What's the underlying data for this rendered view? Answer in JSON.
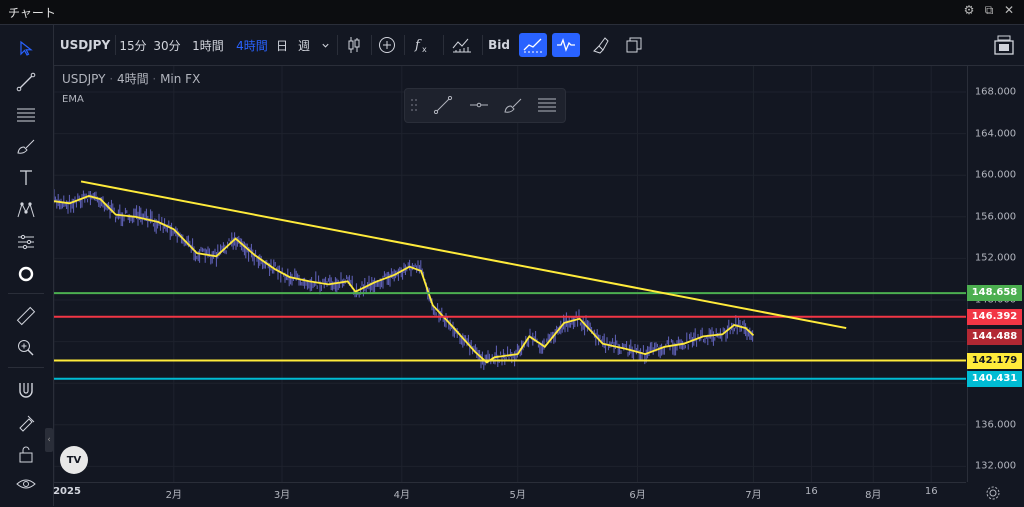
{
  "window": {
    "title": "チャート"
  },
  "toolbar": {
    "symbol": "USDJPY",
    "intervals": [
      {
        "label": "15分",
        "active": false
      },
      {
        "label": "30分",
        "active": false
      },
      {
        "label": "1時間",
        "active": false
      },
      {
        "label": "4時間",
        "active": true
      },
      {
        "label": "日",
        "active": false
      },
      {
        "label": "週",
        "active": false
      }
    ],
    "price_source": "Bid"
  },
  "legend": {
    "symbol": "USDJPY",
    "interval": "4時間",
    "source": "Min FX",
    "indicator": "EMA"
  },
  "price_axis": {
    "ticks": [
      "168.000",
      "164.000",
      "160.000",
      "156.000",
      "152.000",
      "148.000",
      "144.000",
      "140.000",
      "136.000",
      "132.000"
    ]
  },
  "time_axis": {
    "ticks": [
      "2025",
      "2月",
      "3月",
      "4月",
      "5月",
      "6月",
      "7月",
      "16",
      "8月",
      "16"
    ]
  },
  "price_labels": [
    {
      "value": "148.658",
      "bg": "#4caf50",
      "fg": "#ffffff"
    },
    {
      "value": "146.392",
      "bg": "#f23645",
      "fg": "#ffffff"
    },
    {
      "value": "144.488",
      "bg": "#b22833",
      "fg": "#ffffff"
    },
    {
      "value": "142.179",
      "bg": "#ffeb3b",
      "fg": "#131722"
    },
    {
      "value": "140.431",
      "bg": "#00bcd4",
      "fg": "#ffffff"
    }
  ],
  "horizontal_lines": [
    {
      "name": "green",
      "price": 148.658,
      "color": "#4caf50"
    },
    {
      "name": "red",
      "price": 146.392,
      "color": "#f23645"
    },
    {
      "name": "yellow",
      "price": 142.179,
      "color": "#ffeb3b"
    },
    {
      "name": "cyan",
      "price": 140.431,
      "color": "#00bcd4"
    }
  ],
  "trendline": {
    "color": "#ffeb3b",
    "p1": {
      "date": "2025-01-08",
      "price": 159.4
    },
    "p2": {
      "date": "2025-07-25",
      "price": 145.3
    }
  },
  "colors": {
    "background": "#131722",
    "accent": "#2962ff",
    "ema": "#ffeb3b",
    "candle": "#7e7ef0"
  },
  "chart_data": {
    "type": "line",
    "series": [
      {
        "name": "EMA",
        "points": [
          [
            "2025-01-01",
            157.5
          ],
          [
            "2025-01-05",
            157.3
          ],
          [
            "2025-01-10",
            158.0
          ],
          [
            "2025-01-13",
            157.7
          ],
          [
            "2025-01-17",
            156.2
          ],
          [
            "2025-01-22",
            156.0
          ],
          [
            "2025-01-28",
            155.5
          ],
          [
            "2025-02-01",
            154.8
          ],
          [
            "2025-02-07",
            152.5
          ],
          [
            "2025-02-12",
            152.2
          ],
          [
            "2025-02-17",
            153.9
          ],
          [
            "2025-02-22",
            152.3
          ],
          [
            "2025-02-27",
            151.0
          ],
          [
            "2025-03-03",
            150.2
          ],
          [
            "2025-03-08",
            149.8
          ],
          [
            "2025-03-13",
            149.5
          ],
          [
            "2025-03-18",
            149.8
          ],
          [
            "2025-03-20",
            148.8
          ],
          [
            "2025-03-25",
            149.7
          ],
          [
            "2025-03-30",
            150.4
          ],
          [
            "2025-04-03",
            151.2
          ],
          [
            "2025-04-06",
            150.8
          ],
          [
            "2025-04-09",
            147.5
          ],
          [
            "2025-04-14",
            145.5
          ],
          [
            "2025-04-20",
            143.0
          ],
          [
            "2025-04-23",
            142.0
          ],
          [
            "2025-04-25",
            142.5
          ],
          [
            "2025-05-01",
            142.8
          ],
          [
            "2025-05-04",
            144.5
          ],
          [
            "2025-05-08",
            143.5
          ],
          [
            "2025-05-13",
            145.8
          ],
          [
            "2025-05-17",
            146.2
          ],
          [
            "2025-05-23",
            143.8
          ],
          [
            "2025-05-29",
            143.3
          ],
          [
            "2025-06-03",
            142.8
          ],
          [
            "2025-06-08",
            143.5
          ],
          [
            "2025-06-13",
            143.8
          ],
          [
            "2025-06-18",
            144.5
          ],
          [
            "2025-06-23",
            144.7
          ],
          [
            "2025-06-26",
            145.6
          ],
          [
            "2025-06-29",
            145.3
          ],
          [
            "2025-07-01",
            144.6
          ]
        ]
      }
    ],
    "ylim": [
      130.5,
      170.5
    ],
    "xlim": [
      "2025-01-01",
      "2025-08-25"
    ]
  }
}
